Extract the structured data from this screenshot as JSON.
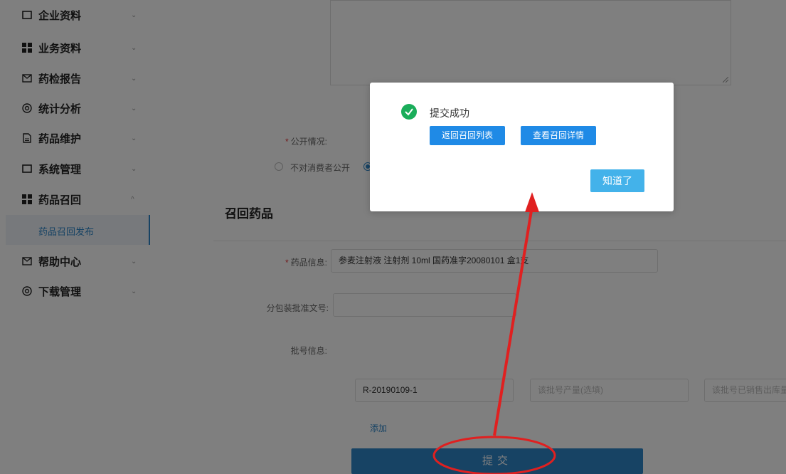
{
  "sidebar": {
    "items": [
      {
        "label": "企业资料",
        "icon": "folder-icon",
        "chevron": "⌄"
      },
      {
        "label": "业务资料",
        "icon": "grid-icon",
        "chevron": "⌄"
      },
      {
        "label": "药检报告",
        "icon": "mail-icon",
        "chevron": "⌄"
      },
      {
        "label": "统计分析",
        "icon": "settings-icon",
        "chevron": "⌄"
      },
      {
        "label": "药品维护",
        "icon": "document-icon",
        "chevron": "⌄"
      },
      {
        "label": "系统管理",
        "icon": "folder-icon",
        "chevron": "⌄"
      },
      {
        "label": "药品召回",
        "icon": "grid-icon",
        "chevron": "^"
      },
      {
        "label": "帮助中心",
        "icon": "mail-icon",
        "chevron": "⌄"
      },
      {
        "label": "下载管理",
        "icon": "settings-icon",
        "chevron": "⌄"
      }
    ],
    "active_sub": "药品召回发布"
  },
  "form": {
    "public_label": "公开情况:",
    "public_option_1": "不对消费者公开",
    "section_title": "召回药品",
    "drug_info_label": "药品信息:",
    "drug_info_value": "参麦注射液 注射剂 10ml 国药准字20080101 盒1支",
    "package_label": "分包装批准文号:",
    "package_value": "",
    "batch_label": "批号信息:",
    "batch_number": "R-20190109-1",
    "batch_output_placeholder": "该批号产量(选填)",
    "batch_sold_placeholder": "该批号已销售出库量",
    "add_link": "添加",
    "submit_label": "提交"
  },
  "modal": {
    "title": "提交成功",
    "back_button": "返回召回列表",
    "view_button": "查看召回详情",
    "ok_button": "知道了"
  },
  "colors": {
    "primary": "#2e86c9",
    "success": "#1aad5a",
    "annotation": "#e02020"
  }
}
